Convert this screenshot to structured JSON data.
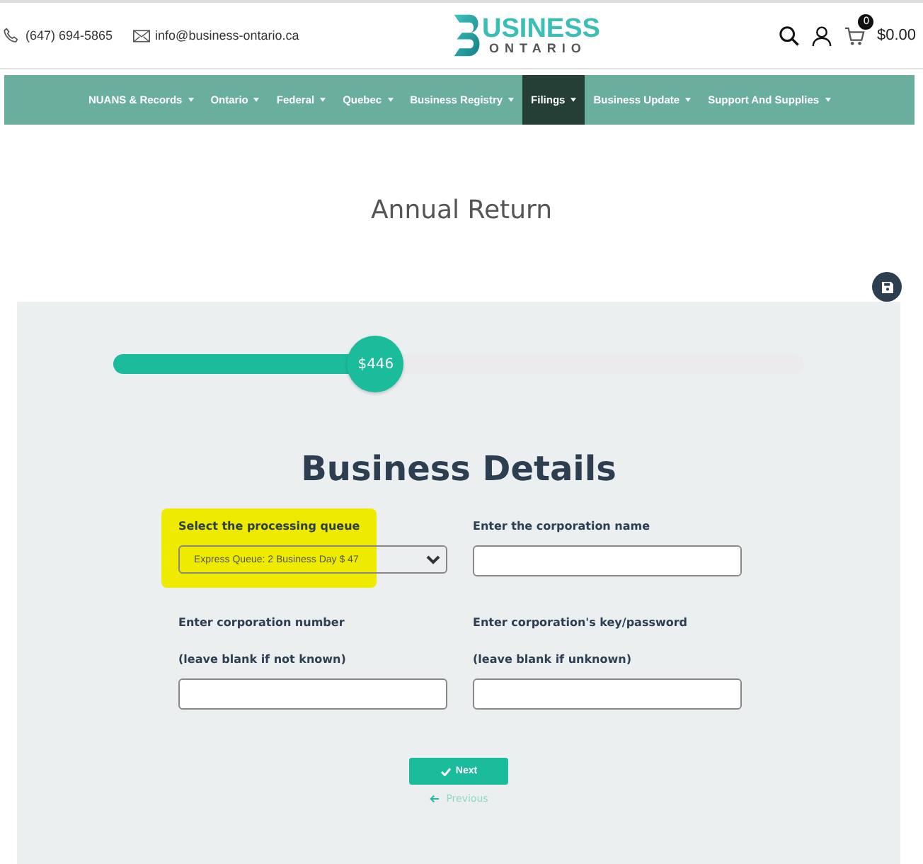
{
  "header": {
    "phone": "(647) 694-5865",
    "email": "info@business-ontario.ca",
    "logo": {
      "top": "USINESS",
      "bottom": "ONTARIO"
    },
    "cart_count": "0",
    "cart_total": "$0.00"
  },
  "nav": [
    {
      "label": "NUANS & Records",
      "selected": false
    },
    {
      "label": "Ontario",
      "selected": false
    },
    {
      "label": "Federal",
      "selected": false
    },
    {
      "label": "Quebec",
      "selected": false
    },
    {
      "label": "Business Registry",
      "selected": false
    },
    {
      "label": "Filings",
      "selected": true
    },
    {
      "label": "Business Update",
      "selected": false
    },
    {
      "label": "Support And Supplies",
      "selected": false
    }
  ],
  "page_title": "Annual Return",
  "progress": {
    "level": 0.38,
    "reading": "$446"
  },
  "form": {
    "heading": "Business Details",
    "fields": [
      {
        "kind": "select",
        "label": "Select the processing queue",
        "value": "Express Queue: 2 Business Day $ 47",
        "highlighted": true
      },
      {
        "kind": "text",
        "label": "Enter the corporation name",
        "highlighted": false
      },
      {
        "kind": "text",
        "label": "Enter corporation number",
        "hint": "(leave blank if not known)",
        "highlighted": false
      },
      {
        "kind": "text",
        "label": "Enter corporation's key/password",
        "hint": "(leave blank if unknown)",
        "highlighted": false
      }
    ],
    "next": "Next",
    "previous": "Previous"
  }
}
